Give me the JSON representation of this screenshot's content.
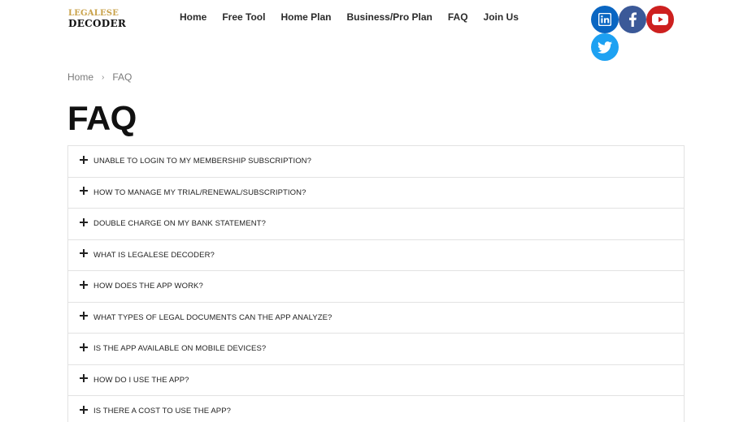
{
  "logo": {
    "top": "LEGALESE",
    "bottom": "DECODER"
  },
  "nav": {
    "items": [
      {
        "label": "Home"
      },
      {
        "label": "Free Tool"
      },
      {
        "label": "Home Plan"
      },
      {
        "label": "Business/Pro Plan"
      },
      {
        "label": "FAQ"
      },
      {
        "label": "Join Us"
      }
    ]
  },
  "social": {
    "icons": [
      "linkedin-icon",
      "facebook-icon",
      "youtube-icon",
      "twitter-icon"
    ]
  },
  "breadcrumb": {
    "home": "Home",
    "current": "FAQ"
  },
  "page_title": "FAQ",
  "faq": {
    "items": [
      "UNABLE TO LOGIN TO MY MEMBERSHIP SUBSCRIPTION?",
      "HOW TO MANAGE MY TRIAL/RENEWAL/SUBSCRIPTION?",
      "DOUBLE CHARGE ON MY BANK STATEMENT?",
      "WHAT IS LEGALESE DECODER?",
      "HOW DOES THE APP WORK?",
      "WHAT TYPES OF LEGAL DOCUMENTS CAN THE APP ANALYZE?",
      "IS THE APP AVAILABLE ON MOBILE DEVICES?",
      "HOW DO I USE THE APP?",
      "IS THERE A COST TO USE THE APP?"
    ]
  },
  "colors": {
    "logo_gold": "#c9a24a",
    "linkedin": "#0a66c2",
    "facebook": "#3b5998",
    "youtube": "#cd201f",
    "twitter": "#1da1f2"
  }
}
